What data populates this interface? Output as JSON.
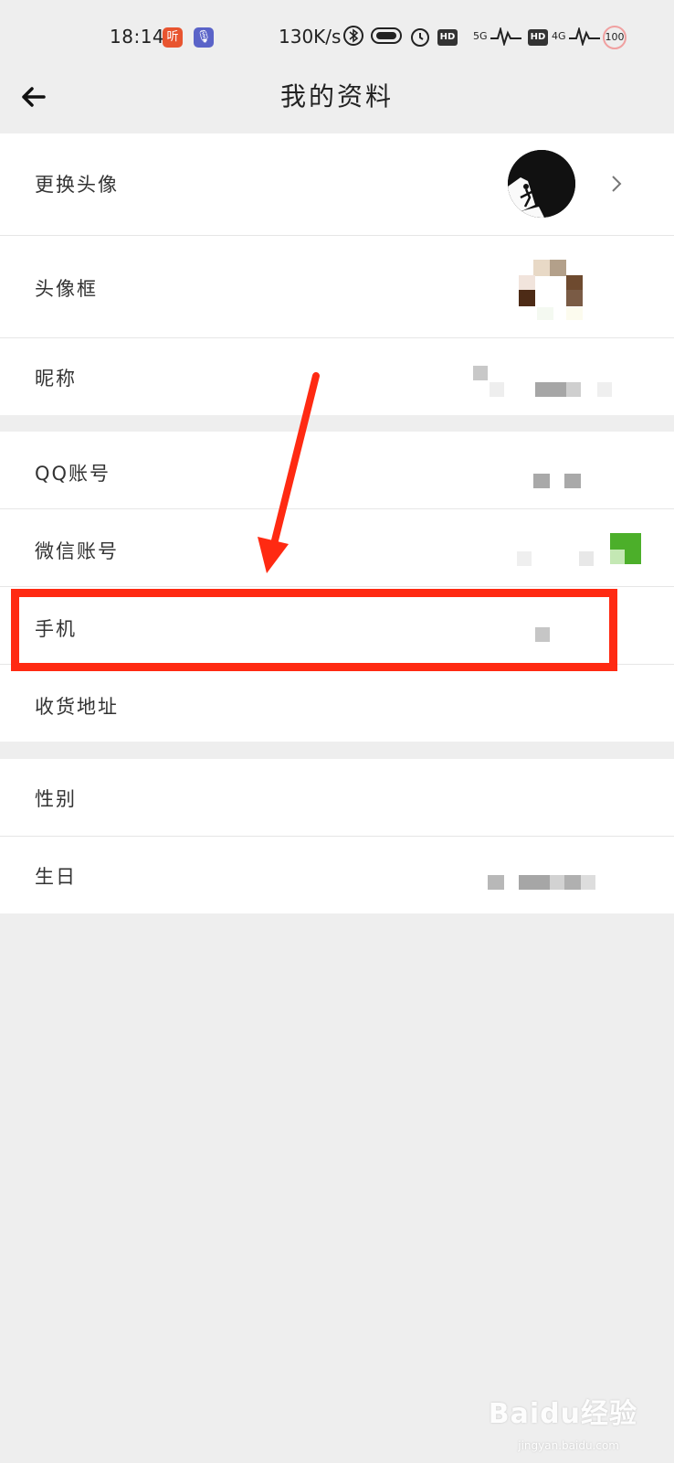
{
  "status_bar": {
    "time": "18:14",
    "listen_app_glyph": "听",
    "voice_app_glyph": "🎙",
    "net_speed": "130K/s",
    "bluetooth_icon": "bluetooth-icon",
    "hd_label_1": "HD",
    "signal_1": "5G",
    "hd_label_2": "HD",
    "signal_2": "4G",
    "battery": "100"
  },
  "nav": {
    "title": "我的资料",
    "back_icon": "back-arrow-icon"
  },
  "rows": {
    "avatar_change": "更换头像",
    "avatar_frame": "头像框",
    "nickname": "昵称",
    "qq_account": "QQ账号",
    "wechat_account": "微信账号",
    "phone": "手机",
    "shipping_address": "收货地址",
    "gender": "性别",
    "birthday": "生日"
  },
  "annotation": {
    "highlight_color": "#ff2a12",
    "arrow_color": "#ff2a12"
  },
  "watermark": {
    "brand": "Baidu经验",
    "url": "jingyan.baidu.com"
  }
}
